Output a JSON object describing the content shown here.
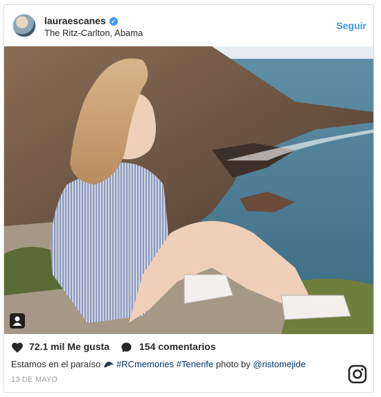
{
  "post": {
    "username": "lauraescanes",
    "location": "The Ritz-Carlton, Abama",
    "follow_label": "Seguir",
    "likes_label": "72.1 mil Me gusta",
    "comments_label": "154 comentarios",
    "caption": {
      "text_prefix": "Estamos en el paraíso ",
      "tag1": "#RCmemories",
      "tag2": "#Tenerife",
      "text_mid": " photo by ",
      "mention": "@ristomejide"
    },
    "date": "13 DE MAYO"
  },
  "icons": {
    "verified": "verified-badge-icon",
    "heart": "heart-icon",
    "comment": "comment-icon",
    "user_tag": "user-tag-icon",
    "wave": "wave-emoji-icon",
    "instagram": "instagram-logo-icon"
  },
  "colors": {
    "link": "#3897f0",
    "hashtag": "#003569",
    "muted": "#999999"
  }
}
